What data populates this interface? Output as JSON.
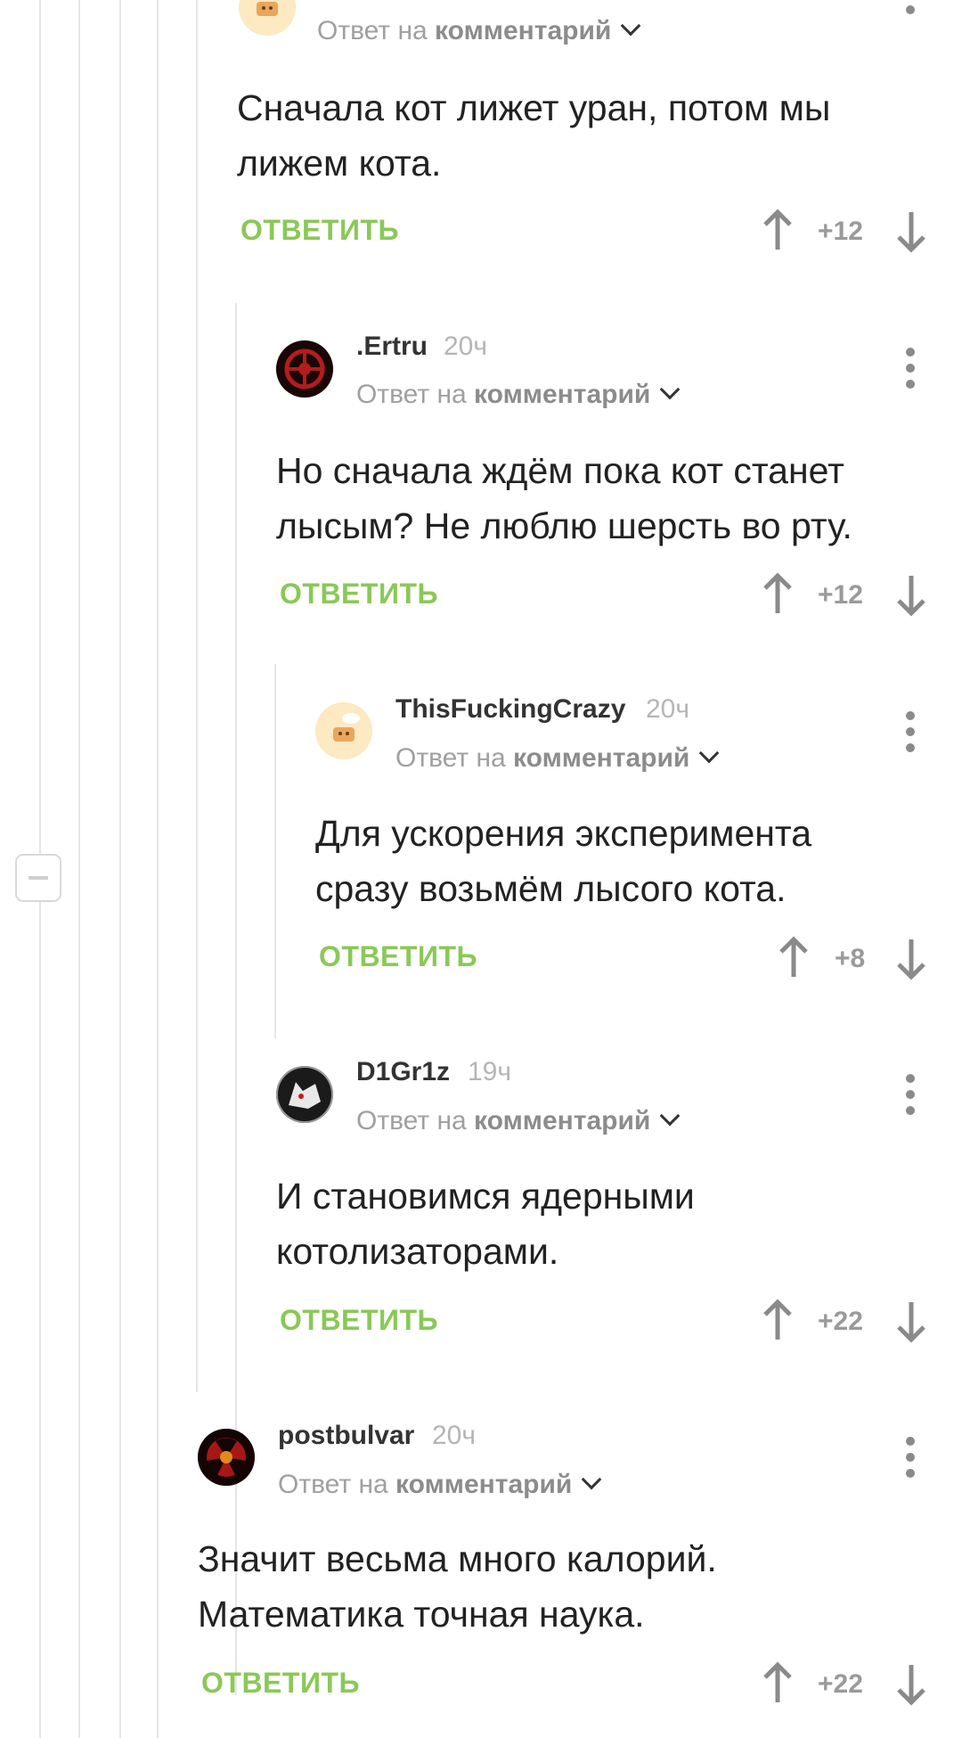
{
  "reply_prefix": "Ответ на",
  "reply_target": "комментарий",
  "reply_button_label": "ОТВЕТИТЬ",
  "colors": {
    "accent_green": "#8ac858",
    "muted_gray": "#9a9a9a",
    "thread_line": "#e6e6e6"
  },
  "comments": [
    {
      "username": "",
      "time": "",
      "avatar_icon": "cat-cartoon-avatar",
      "text_line1": "Сначала кот лижет уран, потом мы",
      "text_line2": "лижем кота.",
      "score": "+12"
    },
    {
      "username": ".Ertru",
      "time": "20ч",
      "avatar_icon": "dark-red-emblem-avatar",
      "text_line1": "Но сначала ждём пока кот станет",
      "text_line2": "лысым? Не люблю шерсть во рту.",
      "score": "+12"
    },
    {
      "username": "ThisFuckingCrazy",
      "time": "20ч",
      "avatar_icon": "cat-cartoon-avatar",
      "text_line1": "Для ускорения эксперимента",
      "text_line2": "сразу возьмём лысого кота.",
      "score": "+8"
    },
    {
      "username": "D1Gr1z",
      "time": "19ч",
      "avatar_icon": "wolf-head-avatar",
      "text_line1": "И становимся ядерными",
      "text_line2": "котолизаторами.",
      "score": "+22"
    },
    {
      "username": "postbulvar",
      "time": "20ч",
      "avatar_icon": "radiation-symbol-avatar",
      "text_line1": "Значит весьма много калорий.",
      "text_line2": "Математика точная наука.",
      "score": "+22"
    }
  ]
}
